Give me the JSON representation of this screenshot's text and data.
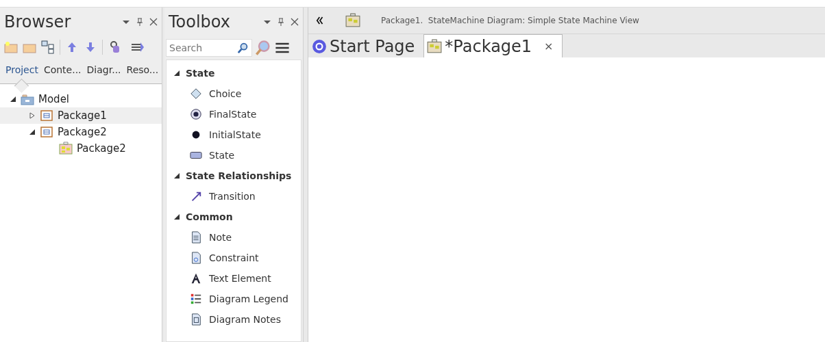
{
  "browser": {
    "title": "Browser",
    "tabs": [
      {
        "label": "Project",
        "selected": true
      },
      {
        "label": "Conte...",
        "selected": false
      },
      {
        "label": "Diagr...",
        "selected": false
      },
      {
        "label": "Reso...",
        "selected": false
      }
    ],
    "tree": [
      {
        "label": "Model",
        "kind": "model",
        "expanded": true,
        "selected": false,
        "children": [
          {
            "label": "Package1",
            "kind": "package",
            "expanded": false,
            "selected": true
          },
          {
            "label": "Package2",
            "kind": "package",
            "expanded": true,
            "selected": false,
            "children": [
              {
                "label": "Package2",
                "kind": "diagram",
                "selected": false
              }
            ]
          }
        ]
      }
    ]
  },
  "toolbox": {
    "title": "Toolbox",
    "search": {
      "placeholder": "Search"
    },
    "groups": [
      {
        "title": "State",
        "expanded": true,
        "items": [
          {
            "label": "Choice",
            "kind": "choice"
          },
          {
            "label": "FinalState",
            "kind": "final"
          },
          {
            "label": "InitialState",
            "kind": "initial"
          },
          {
            "label": "State",
            "kind": "state"
          }
        ]
      },
      {
        "title": "State Relationships",
        "expanded": true,
        "items": [
          {
            "label": "Transition",
            "kind": "transition"
          }
        ]
      },
      {
        "title": "Common",
        "expanded": true,
        "items": [
          {
            "label": "Note",
            "kind": "note"
          },
          {
            "label": "Constraint",
            "kind": "constraint"
          },
          {
            "label": "Text Element",
            "kind": "text"
          },
          {
            "label": "Diagram Legend",
            "kind": "legend"
          },
          {
            "label": "Diagram Notes",
            "kind": "notes"
          }
        ]
      }
    ]
  },
  "main": {
    "path": "Package1.  StateMachine Diagram: Simple State Machine View",
    "tabs": [
      {
        "label": "Start Page",
        "kind": "start",
        "selected": false
      },
      {
        "label": "*Package1",
        "kind": "diagram",
        "selected": true,
        "close": "×"
      }
    ]
  }
}
